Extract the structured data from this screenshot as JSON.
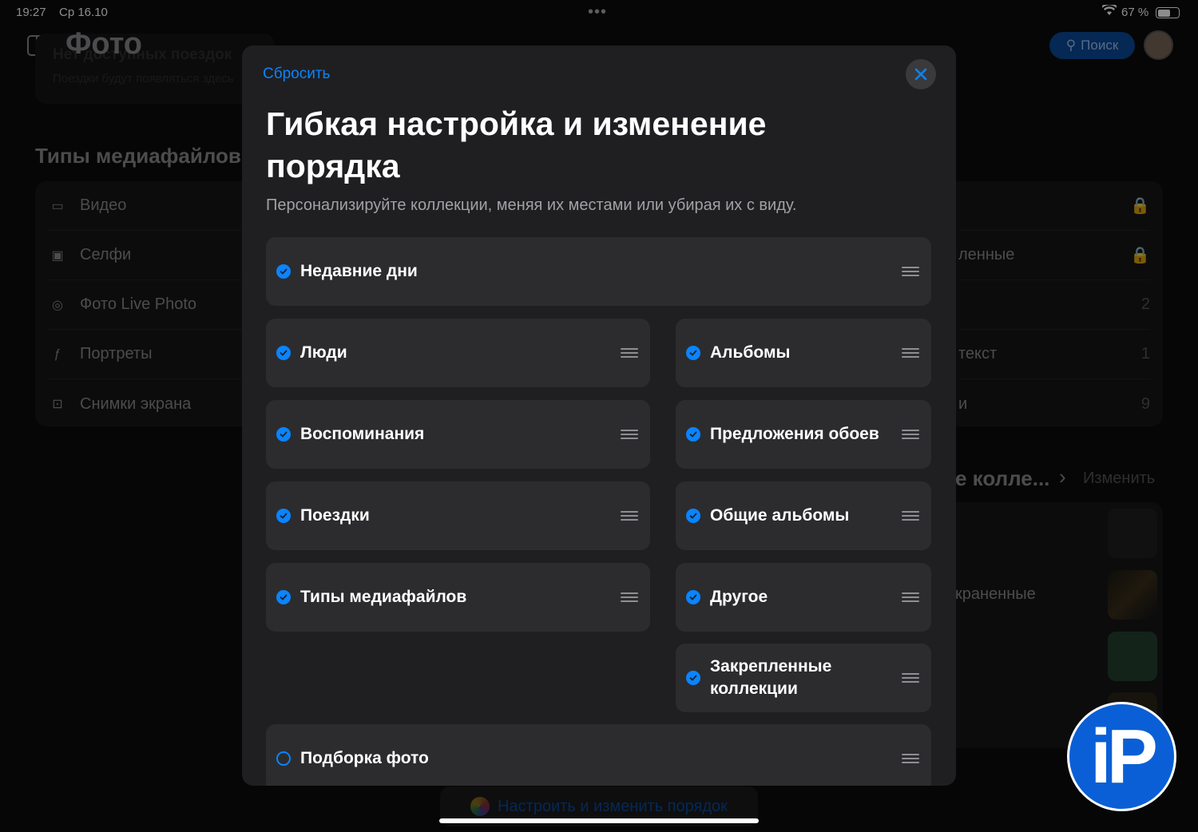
{
  "status": {
    "time": "19:27",
    "date": "Ср 16.10",
    "battery": "67 %"
  },
  "app": {
    "title": "Фото",
    "search_label": "Поиск",
    "trips_empty_title": "Нет доступных поездок",
    "trips_empty_sub": "Поездки будут появляться здесь"
  },
  "media_types": {
    "heading": "Типы медиафайлов",
    "items": [
      {
        "label": "Видео",
        "icon": "video-icon"
      },
      {
        "label": "Селфи",
        "icon": "selfie-icon"
      },
      {
        "label": "Фото Live Photo",
        "icon": "live-photo-icon"
      },
      {
        "label": "Портреты",
        "icon": "portrait-icon"
      },
      {
        "label": "Снимки экрана",
        "icon": "screenshot-icon"
      }
    ]
  },
  "other": {
    "items": [
      {
        "label": "",
        "trail": "lock"
      },
      {
        "label": "ленные",
        "trail": "lock"
      },
      {
        "label": "",
        "trail": "2"
      },
      {
        "label": "текст",
        "trail": "1"
      },
      {
        "label": "и",
        "trail": "9"
      }
    ]
  },
  "pinned": {
    "heading": "е колле...",
    "edit": "Изменить",
    "items": [
      "",
      "краненные",
      "",
      ""
    ]
  },
  "bottom_button": "Настроить и изменить порядок",
  "modal": {
    "reset": "Сбросить",
    "title": "Гибкая настройка и изменение порядка",
    "subtitle": "Персонализируйте коллекции, меняя их местами или убирая их с виду.",
    "items": [
      {
        "label": "Недавние дни",
        "checked": true
      },
      {
        "label": "Люди",
        "checked": true
      },
      {
        "label": "Альбомы",
        "checked": true
      },
      {
        "label": "Воспоминания",
        "checked": true
      },
      {
        "label": "Предложения обоев",
        "checked": true
      },
      {
        "label": "Поездки",
        "checked": true
      },
      {
        "label": "Общие альбомы",
        "checked": true
      },
      {
        "label": "Типы медиафайлов",
        "checked": true
      },
      {
        "label": "Другое",
        "checked": true
      },
      {
        "label": "Закрепленные коллекции",
        "checked": true
      },
      {
        "label": "Подборка фото",
        "checked": false
      }
    ]
  },
  "colors": {
    "accent": "#0a84ff",
    "card": "#2c2c2e",
    "modal": "#1f1f21"
  },
  "watermark": "iP"
}
